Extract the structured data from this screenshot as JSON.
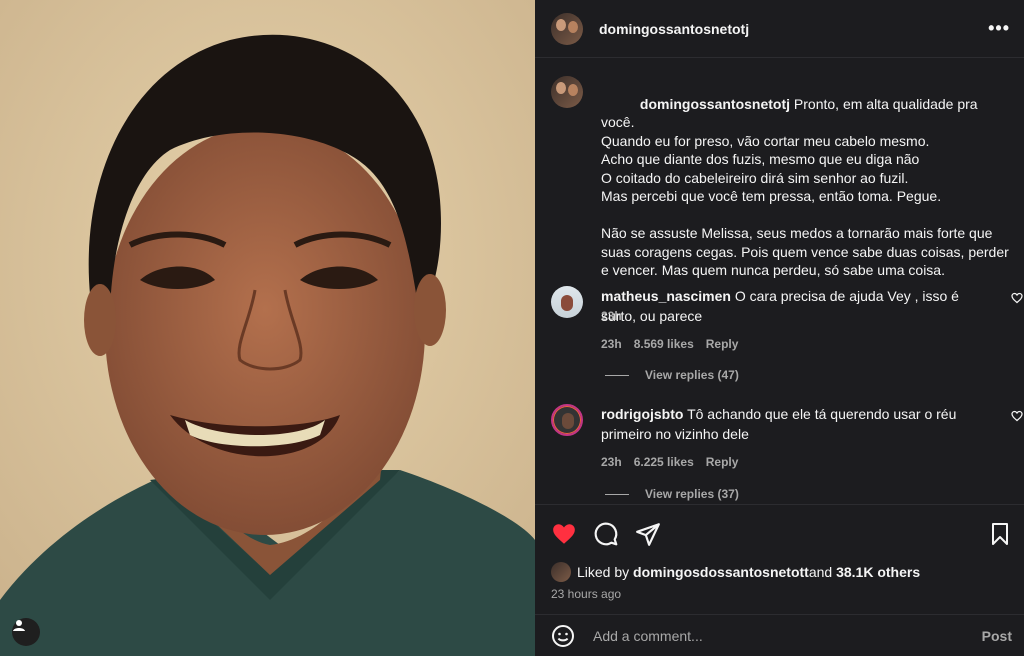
{
  "post": {
    "username": "domingossantosnetotj",
    "caption_username": "domingossantosnetotj",
    "caption_text": " Pronto, em alta qualidade pra você.\nQuando eu for preso, vão cortar meu cabelo mesmo.\nAcho que diante dos fuzis, mesmo que eu diga não\nO coitado do cabeleireiro dirá sim senhor ao fuzil.\nMas percebi que você tem pressa, então toma. Pegue.\n\nNão se assuste Melissa, seus medos a tornarão mais forte que suas coragens cegas. Pois quem vence sabe duas coisas, perder e vencer. Mas quem nunca perdeu, só sabe uma coisa.",
    "caption_time": "23h"
  },
  "comments": [
    {
      "username": "matheus_nascimen",
      "text": " O cara precisa de ajuda Vey , isso é surto, ou parece",
      "time": "23h",
      "likes": "8.569 likes",
      "reply": "Reply",
      "view_replies": "View replies (47)"
    },
    {
      "username": "rodrigojsbto",
      "text": " Tô achando que ele tá querendo usar o réu primeiro no vizinho dele",
      "time": "23h",
      "likes": "6.225 likes",
      "reply": "Reply",
      "view_replies": "View replies (37)"
    }
  ],
  "liked_by": {
    "prefix": "Liked by ",
    "user": "domingosdossantosnetott",
    "and": " and ",
    "others": "38.1K others"
  },
  "time_ago": "23 hours ago",
  "add_comment": {
    "placeholder": "Add a comment...",
    "post_label": "Post"
  },
  "more_label": "•••",
  "colors": {
    "panel_bg": "#1c1c1f",
    "heart": "#ff3040",
    "muted": "#a8a8a8"
  },
  "icons": [
    "heart-icon",
    "comment-icon",
    "share-icon",
    "bookmark-icon",
    "emoji-icon",
    "user-tag-icon",
    "more-icon"
  ]
}
